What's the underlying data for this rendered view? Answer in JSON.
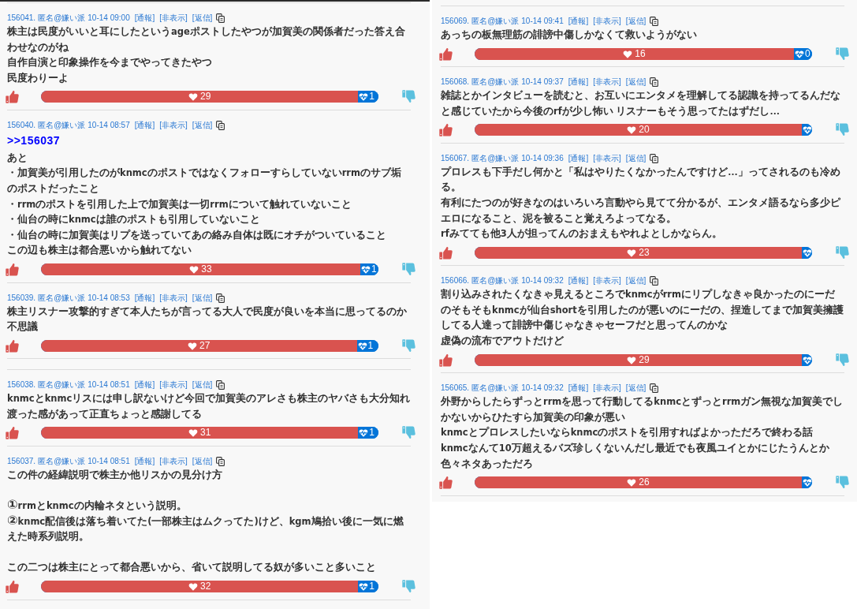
{
  "columns": [
    {
      "posts": [
        {
          "kind": "post",
          "number": "156041.",
          "author": "匿名@嫌い派",
          "time": "10-14 09:00",
          "actions": [
            "[通報]",
            "[非表示]",
            "[返信]"
          ],
          "paragraphs": [
            [
              "株主は民度がいいと耳にしたというageポストしたやつが加賀美の関係者だった答え合わせなのがね",
              "自作自演と印象操作を今までやってきたやつ",
              "民度わりーよ"
            ]
          ],
          "likes": "29",
          "dislikes": "1",
          "level": 0.94
        },
        {
          "kind": "post",
          "number": "156040.",
          "author": "匿名@嫌い派",
          "time": "10-14 08:57",
          "actions": [
            "[通報]",
            "[非表示]",
            "[返信]"
          ],
          "reply_to": ">>156037",
          "paragraphs": [
            [
              "あと",
              "・加賀美が引用したのがknmcのポストではなくフォローすらしていないrrmのサブ垢のポストだったこと",
              "・rrmのポストを引用した上で加賀美は一切rrmについて触れていないこと",
              "・仙台の時にknmcは誰のポストも引用していないこと",
              "・仙台の時に加賀美はリプを送っていてあの絡み自体は既にオチがついていること",
              "この辺も株主は都合悪いから触れてない"
            ]
          ],
          "likes": "33",
          "dislikes": "1",
          "level": 0.946
        },
        {
          "kind": "post",
          "number": "156039.",
          "author": "匿名@嫌い派",
          "time": "10-14 08:53",
          "actions": [
            "[通報]",
            "[非表示]",
            "[返信]"
          ],
          "paragraphs": [
            [
              "株主リスナー攻撃的すぎて本人たちが言ってる大人で民度が良いを本当に思ってるのか不思議"
            ]
          ],
          "likes": "27",
          "dislikes": "1",
          "level": 0.936
        },
        {
          "kind": "divider"
        },
        {
          "kind": "post",
          "number": "156038.",
          "author": "匿名@嫌い派",
          "time": "10-14 08:51",
          "actions": [
            "[通報]",
            "[非表示]",
            "[返信]"
          ],
          "paragraphs": [
            [
              "knmcとknmcリスには申し訳ないけど今回で加賀美のアレさも株主のヤバさも大分知れ渡った感があって正直ちょっと感謝してる"
            ]
          ],
          "likes": "31",
          "dislikes": "1",
          "level": 0.94
        },
        {
          "kind": "post",
          "number": "156037.",
          "author": "匿名@嫌い派",
          "time": "10-14 08:51",
          "actions": [
            "[通報]",
            "[非表示]",
            "[返信]"
          ],
          "paragraphs": [
            [
              "この件の経緯説明で株主か他リスかの見分け方"
            ],
            [
              "①rrmとknmcの内輪ネタという説明。",
              "②knmc配信後は落ち着いてた(一部株主はムクってた)けど、kgm鳩拾い後に一気に燃えた時系列説明。"
            ],
            [
              "この二つは株主にとって都合悪いから、省いて説明してる奴が多いこと多いこと"
            ]
          ],
          "likes": "32",
          "dislikes": "1",
          "level": 0.94
        }
      ]
    },
    {
      "posts": [
        {
          "kind": "post",
          "number": "156069.",
          "author": "匿名@嫌い派",
          "time": "10-14 09:41",
          "actions": [
            "[通報]",
            "[非表示]",
            "[返信]"
          ],
          "paragraphs": [
            [
              "あっちの板無理筋の誹謗中傷しかなくて救いようがない"
            ]
          ],
          "likes": "16",
          "dislikes": "0",
          "level": 0.946
        },
        {
          "kind": "post",
          "number": "156068.",
          "author": "匿名@嫌い派",
          "time": "10-14 09:37",
          "actions": [
            "[通報]",
            "[非表示]",
            "[返信]"
          ],
          "paragraphs": [
            [
              "雑誌とかインタビューを読むと、お互いにエンタメを理解してる認識を持ってるんだなと感じていたから今後のrfが少し怖い リスナーもそう思ってたはずだし…"
            ]
          ],
          "likes": "20",
          "level": 0.97
        },
        {
          "kind": "post",
          "number": "156067.",
          "author": "匿名@嫌い派",
          "time": "10-14 09:36",
          "actions": [
            "[通報]",
            "[非表示]",
            "[返信]"
          ],
          "paragraphs": [
            [
              "プロレスも下手だし何かと「私はやりたくなかったんですけど…」ってされるのも冷める。",
              "有利にたつのが好きなのはいろいろ言動やら見てて分かるが、エンタメ語るなら多少ピエロになること、泥を被ること覚えろよってなる。",
              "rfみてても他3人が担ってんのおまえもやれよとしかならん。"
            ]
          ],
          "likes": "23",
          "level": 0.972
        },
        {
          "kind": "post",
          "number": "156066.",
          "author": "匿名@嫌い派",
          "time": "10-14 09:32",
          "actions": [
            "[通報]",
            "[非表示]",
            "[返信]"
          ],
          "paragraphs": [
            [
              "割り込みされたくなきゃ見えるところでknmcがrrmにリプしなきゃ良かったのにーだのそもそもknmcが仙台shortを引用したのが悪いのにーだの、捏造してまで加賀美擁護してる人達って誹謗中傷じゃなきゃセーフだと思ってんのかな",
              "虚偽の流布でアウトだけど"
            ]
          ],
          "likes": "29",
          "level": 0.974
        },
        {
          "kind": "post",
          "number": "156065.",
          "author": "匿名@嫌い派",
          "time": "10-14 09:32",
          "actions": [
            "[通報]",
            "[非表示]",
            "[返信]"
          ],
          "paragraphs": [
            [
              "外野からしたらずっとrrmを思って行動してるknmcとずっとrrmガン無視な加賀美でしかないからひたすら加賀美の印象が悪い",
              "knmcとプロレスしたいならknmcのポストを引用すればよかっただろで終わる話",
              "knmcなんて10万超えるバズ珍しくないんだし最近でも夜風ユイとかにじたうんとか",
              "色々ネタあっただろ"
            ]
          ],
          "likes": "26",
          "level": 0.972
        }
      ]
    }
  ]
}
